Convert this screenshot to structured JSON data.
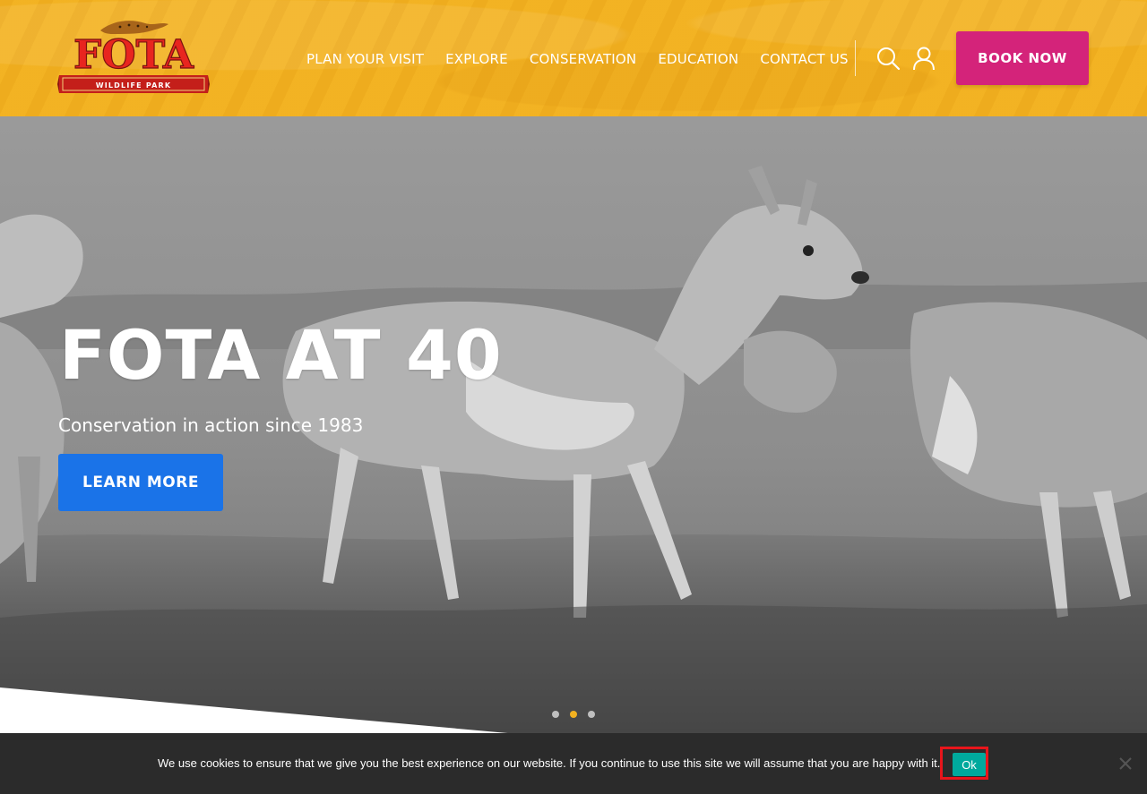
{
  "brand": {
    "logo_word": "FOTA",
    "logo_tagline": "WILDLIFE PARK",
    "primary_color": "#f2b120",
    "accent_color": "#d4237a",
    "button_color": "#1a73e8"
  },
  "nav": {
    "items": [
      {
        "label": "PLAN YOUR VISIT"
      },
      {
        "label": "EXPLORE"
      },
      {
        "label": "CONSERVATION"
      },
      {
        "label": "EDUCATION"
      },
      {
        "label": "CONTACT US"
      }
    ],
    "search_icon": "search-icon",
    "account_icon": "user-icon",
    "book_label": "BOOK NOW"
  },
  "hero": {
    "title": "FOTA AT 40",
    "subtitle": "Conservation in action since 1983",
    "button_label": "LEARN MORE",
    "slides": 3,
    "active_slide": 2
  },
  "cookie": {
    "message": "We use cookies to ensure that we give you the best experience on our website. If you continue to use this site we will assume that you are happy with it.",
    "ok_label": "Ok",
    "close_icon": "close-icon"
  }
}
